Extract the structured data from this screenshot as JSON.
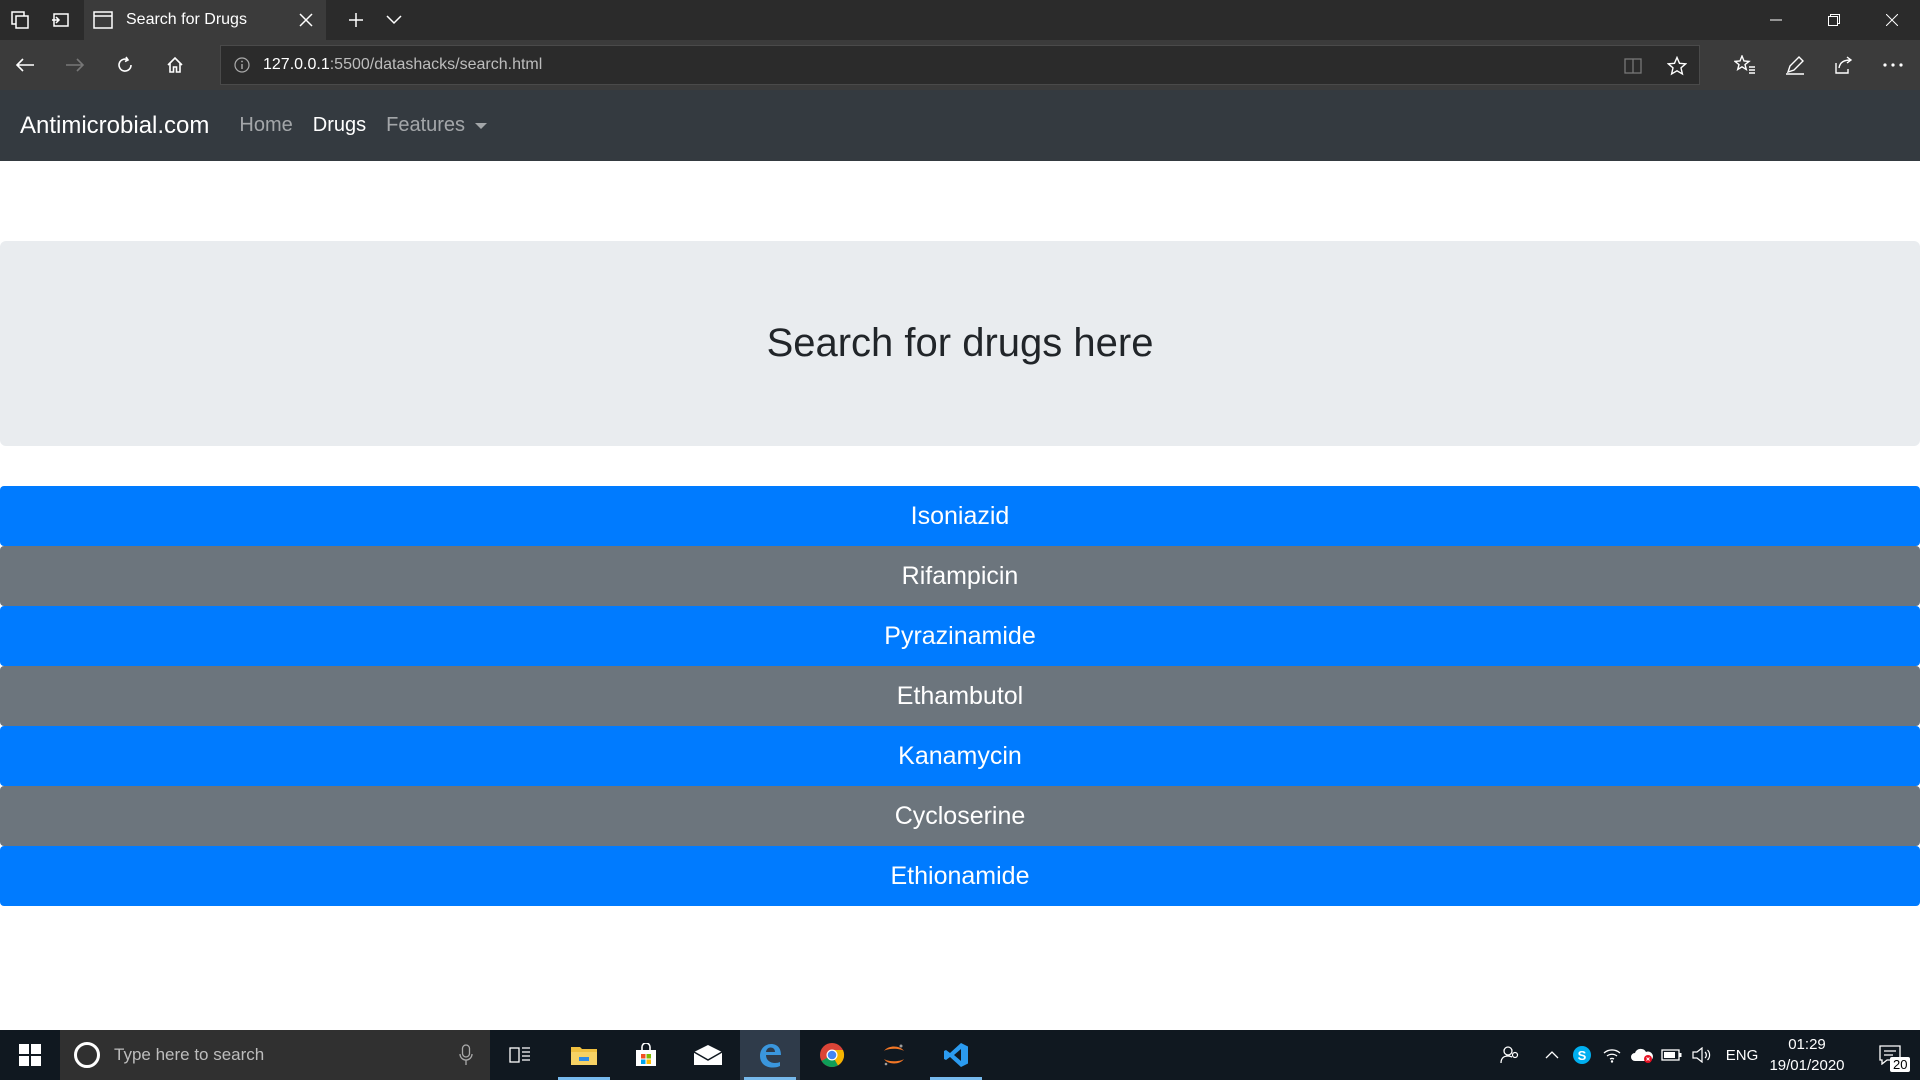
{
  "browser": {
    "tab_title": "Search for Drugs",
    "url_host": "127.0.0.1",
    "url_rest": ":5500/datashacks/search.html"
  },
  "site": {
    "brand": "Antimicrobial.com",
    "nav": {
      "home": "Home",
      "drugs": "Drugs",
      "features": "Features"
    }
  },
  "jumbotron": {
    "title": "Search for drugs here"
  },
  "drugs": [
    "Isoniazid",
    "Rifampicin",
    "Pyrazinamide",
    "Ethambutol",
    "Kanamycin",
    "Cycloserine",
    "Ethionamide"
  ],
  "taskbar": {
    "search_placeholder": "Type here to search",
    "language": "ENG",
    "time": "01:29",
    "date": "19/01/2020",
    "notification_count": "20"
  },
  "colors": {
    "primary": "#007bff",
    "secondary": "#6c757d",
    "navbar": "#343a40",
    "jumbotron": "#e9ecef"
  },
  "icons": [
    "tab-actions-icon",
    "set-aside-icon",
    "page-icon",
    "close-icon",
    "plus-icon",
    "chevron-down-icon",
    "minimize-icon",
    "restore-icon",
    "back-icon",
    "forward-icon",
    "refresh-icon",
    "home-icon",
    "info-icon",
    "reading-view-icon",
    "star-icon",
    "favorites-icon",
    "pen-icon",
    "share-icon",
    "more-icon",
    "windows-icon",
    "search-icon",
    "mic-icon",
    "task-view-icon",
    "file-explorer-icon",
    "store-icon",
    "mail-icon",
    "edge-icon",
    "chrome-icon",
    "jupyter-icon",
    "vscode-icon",
    "people-icon",
    "chevron-up-icon",
    "skype-icon",
    "wifi-icon",
    "onedrive-icon",
    "battery-icon",
    "volume-icon",
    "notification-icon"
  ]
}
